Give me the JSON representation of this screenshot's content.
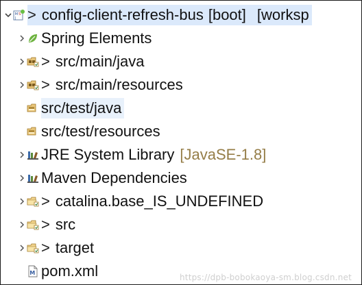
{
  "explorer": {
    "root": {
      "dirty": ">",
      "name": "config-client-refresh-bus",
      "tag": "[boot]",
      "decoration": "[worksp"
    },
    "items": [
      {
        "dirty": "",
        "label": "Spring Elements",
        "decoration": "",
        "icon": "spring-leaf-icon"
      },
      {
        "dirty": ">",
        "label": "src/main/java",
        "decoration": "",
        "icon": "source-folder-icon"
      },
      {
        "dirty": ">",
        "label": "src/main/resources",
        "decoration": "",
        "icon": "source-folder-icon"
      },
      {
        "dirty": "",
        "label": "src/test/java",
        "decoration": "",
        "icon": "source-folder-icon"
      },
      {
        "dirty": "",
        "label": "src/test/resources",
        "decoration": "",
        "icon": "source-folder-icon"
      },
      {
        "dirty": "",
        "label": "JRE System Library",
        "decoration": "[JavaSE-1.8]",
        "icon": "library-icon"
      },
      {
        "dirty": "",
        "label": "Maven Dependencies",
        "decoration": "",
        "icon": "library-icon"
      },
      {
        "dirty": ">",
        "label": "catalina.base_IS_UNDEFINED",
        "decoration": "",
        "icon": "folder-icon"
      },
      {
        "dirty": ">",
        "label": "src",
        "decoration": "",
        "icon": "folder-icon"
      },
      {
        "dirty": ">",
        "label": "target",
        "decoration": "",
        "icon": "folder-icon"
      },
      {
        "dirty": "",
        "label": "pom.xml",
        "decoration": "",
        "icon": "xml-file-icon"
      }
    ]
  },
  "watermark": "https://dpb-bobokaoya-sm.blog.csdn.net",
  "colors": {
    "root_highlight": "#dbe9fb",
    "selection": "#e8f1fb",
    "decoration": "#957d47",
    "text": "#111111"
  }
}
